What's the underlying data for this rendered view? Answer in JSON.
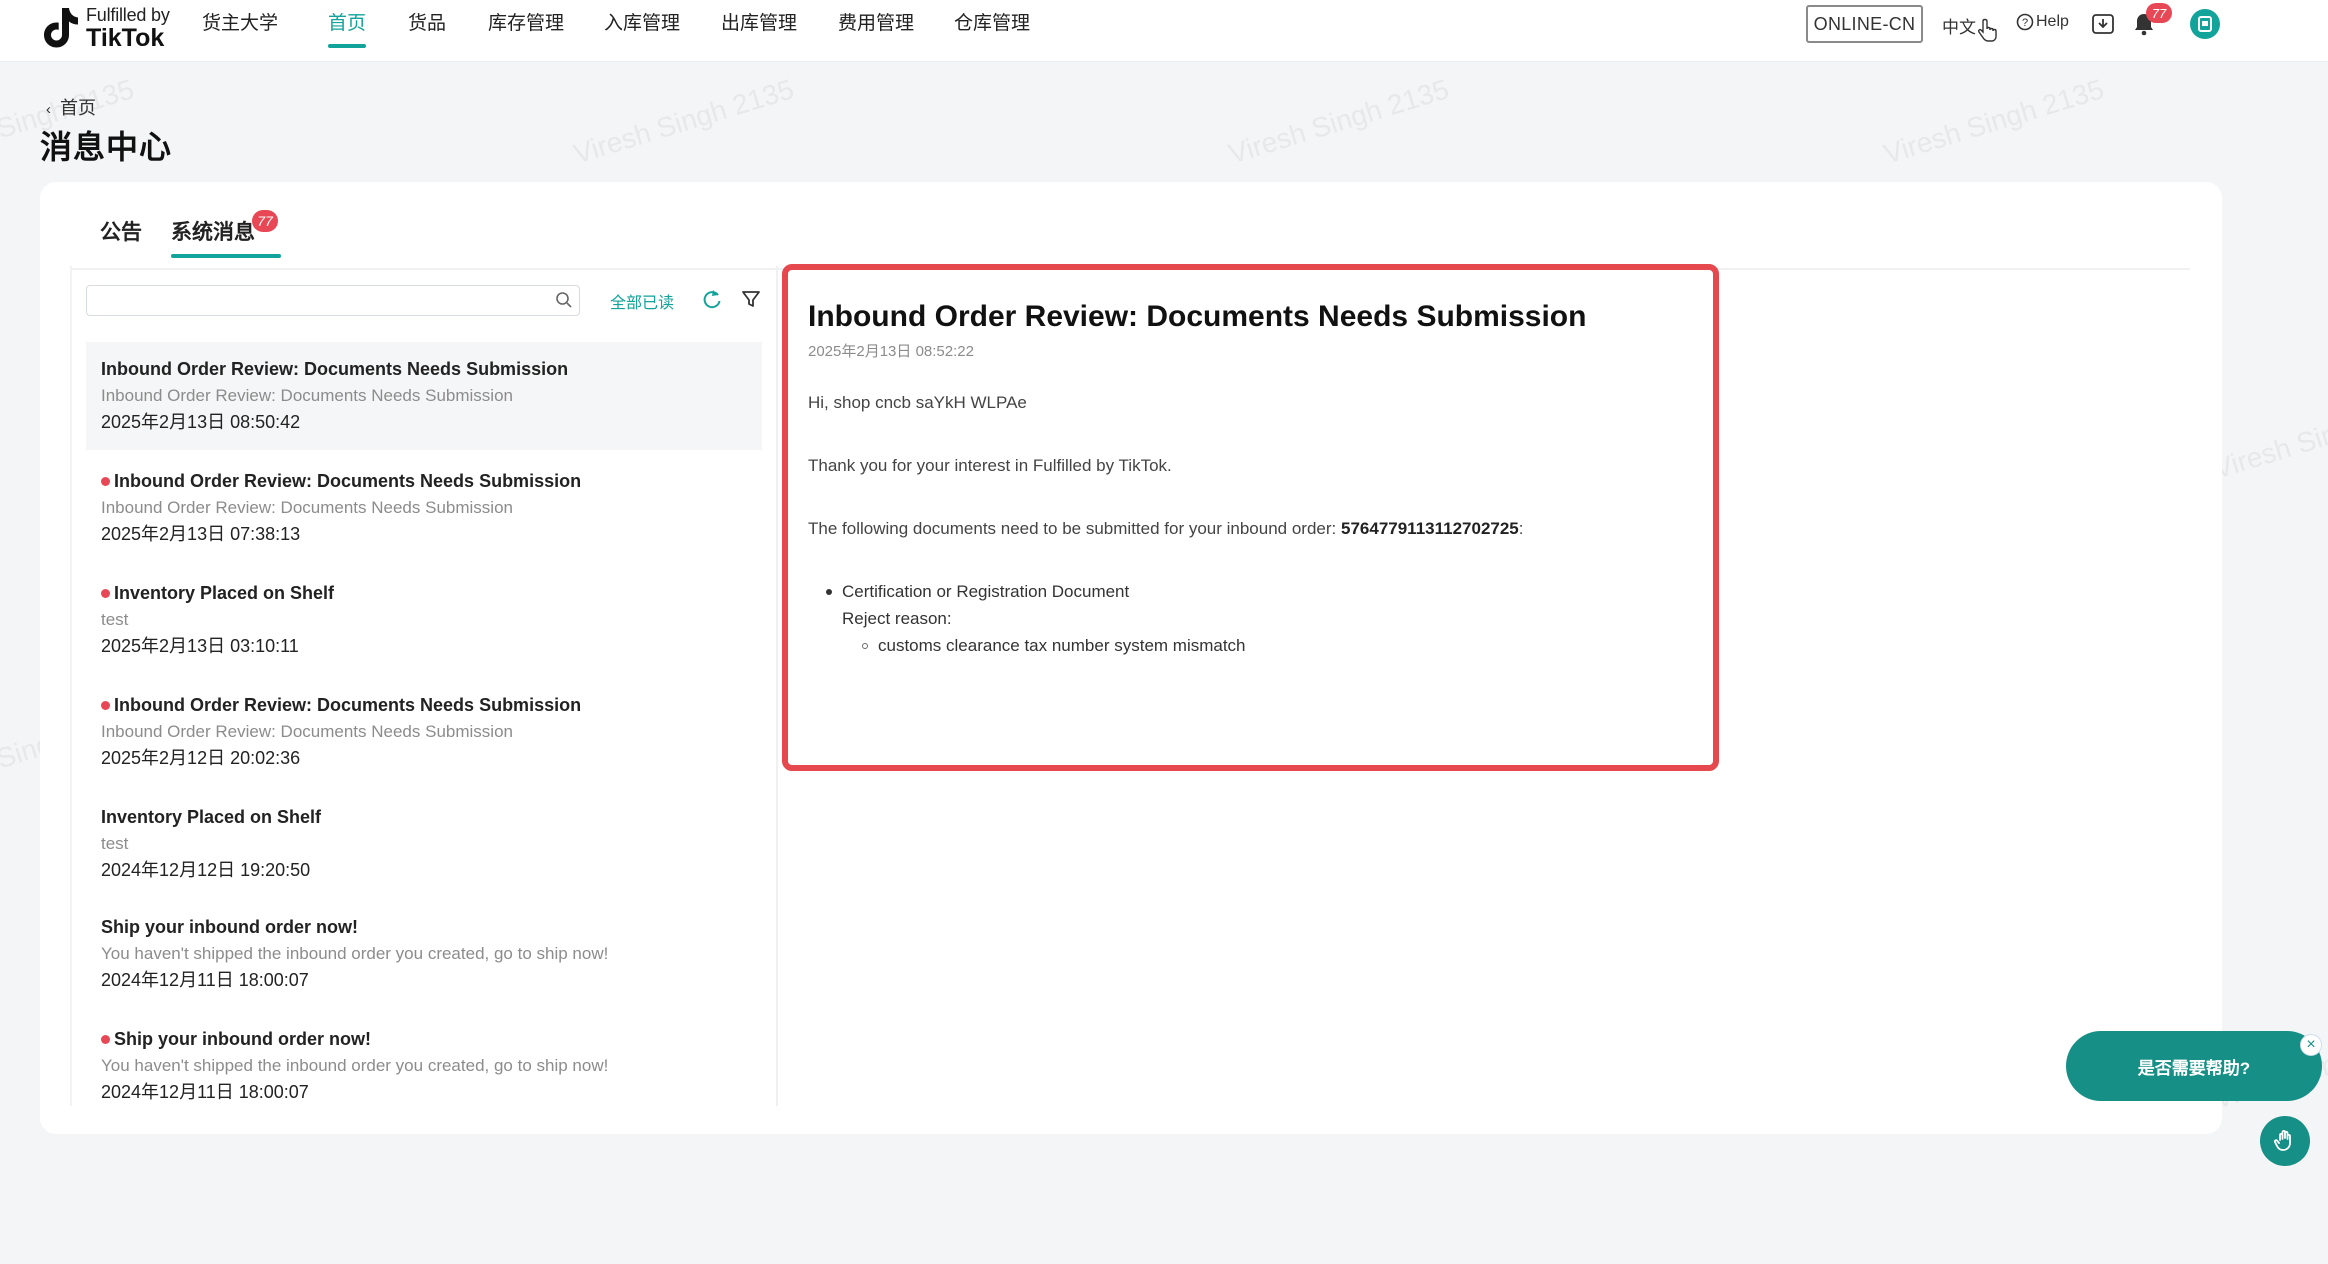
{
  "brand": {
    "line1": "Fulfilled by",
    "line2": "TikTok"
  },
  "nav": {
    "items": [
      {
        "label": "货主大学"
      },
      {
        "label": "首页"
      },
      {
        "label": "货品"
      },
      {
        "label": "库存管理"
      },
      {
        "label": "入库管理"
      },
      {
        "label": "出库管理"
      },
      {
        "label": "费用管理"
      },
      {
        "label": "仓库管理"
      }
    ],
    "active_index": 1,
    "env": "ONLINE-CN",
    "language": "中文",
    "help": "Help",
    "notification_count": "77"
  },
  "page": {
    "breadcrumb": "首页",
    "title": "消息中心"
  },
  "tabs": [
    {
      "label": "公告"
    },
    {
      "label": "系统消息",
      "badge": "77"
    }
  ],
  "list": {
    "search_value": "",
    "mark_all_read": "全部已读",
    "messages": [
      {
        "title": "Inbound Order Review: Documents Needs Submission",
        "summary": "Inbound Order Review: Documents Needs Submission",
        "date": "2025年2月13日 08:50:42",
        "unread": false,
        "selected": true
      },
      {
        "title": "Inbound Order Review: Documents Needs Submission",
        "summary": "Inbound Order Review: Documents Needs Submission",
        "date": "2025年2月13日 07:38:13",
        "unread": true,
        "selected": false
      },
      {
        "title": "Inventory Placed on Shelf",
        "summary": "test",
        "date": "2025年2月13日 03:10:11",
        "unread": true,
        "selected": false
      },
      {
        "title": "Inbound Order Review: Documents Needs Submission",
        "summary": "Inbound Order Review: Documents Needs Submission",
        "date": "2025年2月12日 20:02:36",
        "unread": true,
        "selected": false
      },
      {
        "title": "Inventory Placed on Shelf",
        "summary": "test",
        "date": "2024年12月12日 19:20:50",
        "unread": false,
        "selected": false
      },
      {
        "title": "Ship your inbound order now!",
        "summary": "You haven't shipped the inbound order you created, go to ship now!",
        "date": "2024年12月11日 18:00:07",
        "unread": false,
        "selected": false
      },
      {
        "title": "Ship your inbound order now!",
        "summary": "You haven't shipped the inbound order you created, go to ship now!",
        "date": "2024年12月11日 18:00:07",
        "unread": true,
        "selected": false
      }
    ]
  },
  "detail": {
    "title": "Inbound Order Review: Documents Needs Submission",
    "date": "2025年2月13日 08:52:22",
    "greeting": "Hi, shop cncb saYkH WLPAe",
    "thanks": "Thank you for your interest in Fulfilled by TikTok.",
    "docs_intro": "The following documents need to be submitted for your inbound order:",
    "order_number": "5764779113112702725",
    "docs_intro_suffix": ":",
    "document_name": "Certification or Registration Document",
    "reject_label": "Reject reason:",
    "reject_reason": "customs clearance tax number system mismatch"
  },
  "help_widget": {
    "prompt": "是否需要帮助?",
    "close": "×"
  },
  "watermark": "Viresh Singh 2135",
  "colors": {
    "accent": "#12a39a",
    "alert": "#e84855",
    "highlight_border": "#e5484d",
    "help_bg": "#168f86"
  },
  "icons": [
    "tiktok-logo-icon",
    "search-icon",
    "refresh-icon",
    "filter-icon",
    "help-circle-icon",
    "download-icon",
    "bell-icon",
    "avatar-icon",
    "chevron-left-icon",
    "cursor-icon",
    "hand-icon",
    "close-icon"
  ]
}
